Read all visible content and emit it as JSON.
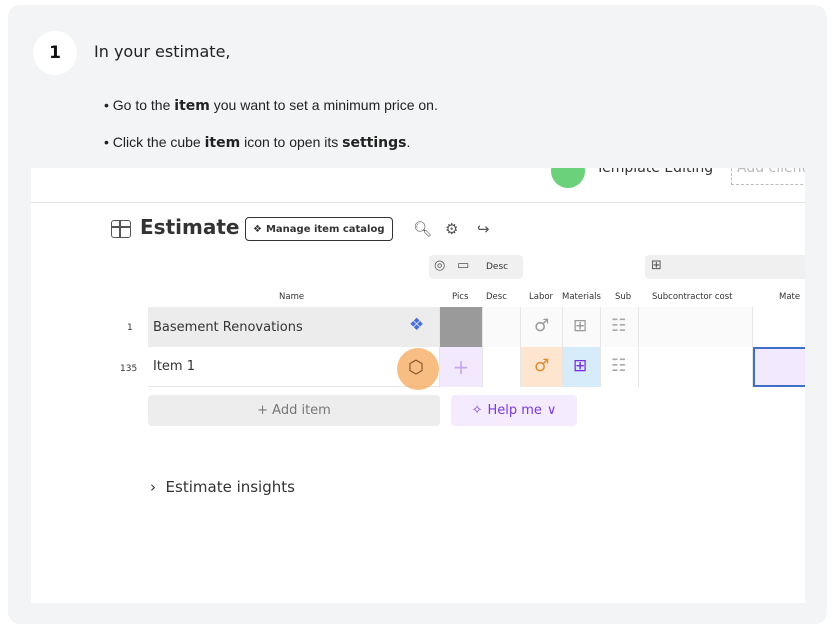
{
  "step": {
    "number": "1",
    "title": "In your estimate,"
  },
  "bullets": [
    {
      "prefix": "• Go to the ",
      "bold1": "item",
      "middle": " you want to set a minimum price on.",
      "bold2": "",
      "suffix": ""
    },
    {
      "prefix": "• Click the cube ",
      "bold1": "item",
      "middle": " icon to open its ",
      "bold2": "settings",
      "suffix": "."
    }
  ],
  "screenshot": {
    "top_text": "Template Editing",
    "add_slot_text": "Add client",
    "estimate_title": "Estimate",
    "catalog_button": "Manage item catalog",
    "column_groups": {
      "desc_label": "Desc"
    },
    "columns": [
      "Name",
      "Pics",
      "Desc",
      "Labor",
      "Materials",
      "Sub",
      "Subcontractor cost",
      "Mate"
    ],
    "rows": [
      {
        "number": "1",
        "name": "Basement Renovations"
      },
      {
        "number": "135",
        "name": "Item 1"
      }
    ],
    "add_item": "+ Add item",
    "help_me": "Help me",
    "insights": "Estimate insights"
  },
  "colors": {
    "highlight": "#f4a75a",
    "labor_bg": "#fde5cf",
    "materials_bg": "#d7ecfb",
    "cost_bg": "#f3e9ff",
    "selected_border": "#3f6fc9"
  },
  "icons": [
    "search-icon",
    "gear-icon",
    "export-icon",
    "cube-icon",
    "person-icon",
    "box-icon",
    "truck-icon",
    "sparkle-icon",
    "chevron-down-icon",
    "chevron-right-icon"
  ]
}
